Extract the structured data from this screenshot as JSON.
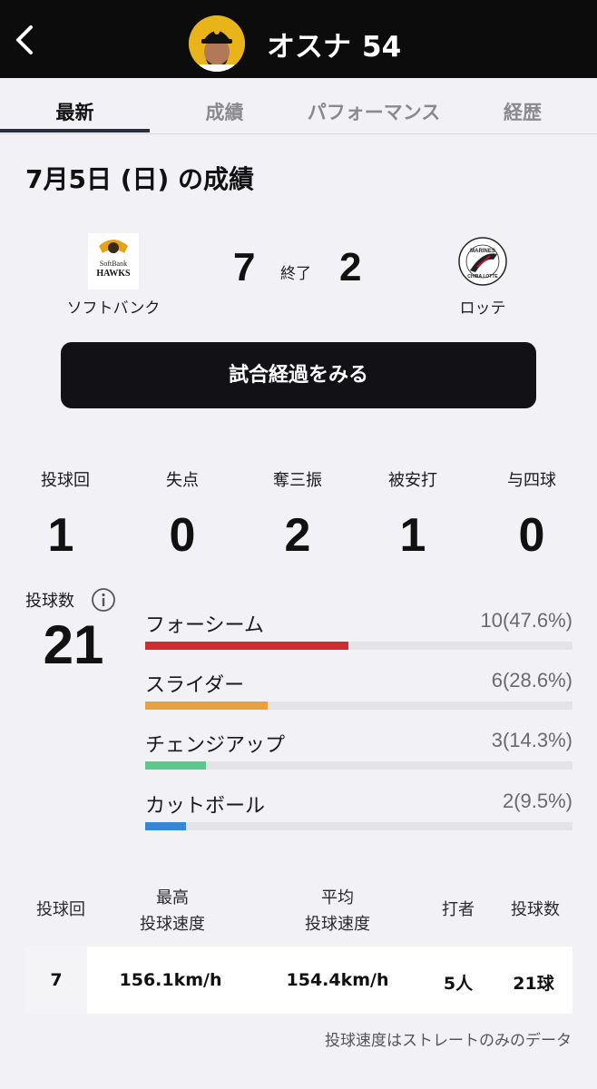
{
  "header": {
    "player_name": "オスナ",
    "player_number": "54"
  },
  "tabs": [
    {
      "label": "最新"
    },
    {
      "label": "成績"
    },
    {
      "label": "パフォーマンス"
    },
    {
      "label": "経歴"
    }
  ],
  "game": {
    "date_title": "7月5日 (日) の成績",
    "home_team": {
      "name": "ソフトバンク",
      "logo_text_1": "SoftBank",
      "logo_text_2": "HAWKS",
      "score": "7"
    },
    "away_team": {
      "name": "ロッテ",
      "logo_text_1": "MARINES",
      "logo_text_2": "CHIBA LOTTE",
      "score": "2"
    },
    "status": "終了",
    "button_label": "試合経過をみる"
  },
  "stats": [
    {
      "label": "投球回",
      "value": "1"
    },
    {
      "label": "失点",
      "value": "0"
    },
    {
      "label": "奪三振",
      "value": "2"
    },
    {
      "label": "被安打",
      "value": "1"
    },
    {
      "label": "与四球",
      "value": "0"
    }
  ],
  "pitch_count": {
    "label": "投球数",
    "value": "21",
    "info_icon": "info-circle-icon"
  },
  "pitch_types": [
    {
      "name": "フォーシーム",
      "count": "10(47.6%)",
      "fraction": 0.476,
      "color": "#c8302c"
    },
    {
      "name": "スライダー",
      "count": "6(28.6%)",
      "fraction": 0.286,
      "color": "#eaa03e"
    },
    {
      "name": "チェンジアップ",
      "count": "3(14.3%)",
      "fraction": 0.143,
      "color": "#5bc98b"
    },
    {
      "name": "カットボール",
      "count": "2(9.5%)",
      "fraction": 0.095,
      "color": "#3a86d4"
    }
  ],
  "speed_table": {
    "headers": [
      {
        "line1": "投球回",
        "line2": ""
      },
      {
        "line1": "最高",
        "line2": "投球速度"
      },
      {
        "line1": "平均",
        "line2": "投球速度"
      },
      {
        "line1": "打者",
        "line2": ""
      },
      {
        "line1": "投球数",
        "line2": ""
      }
    ],
    "row": [
      "7",
      "156.1km/h",
      "154.4km/h",
      "5人",
      "21球"
    ],
    "note": "投球速度はストレートのみのデータ"
  }
}
